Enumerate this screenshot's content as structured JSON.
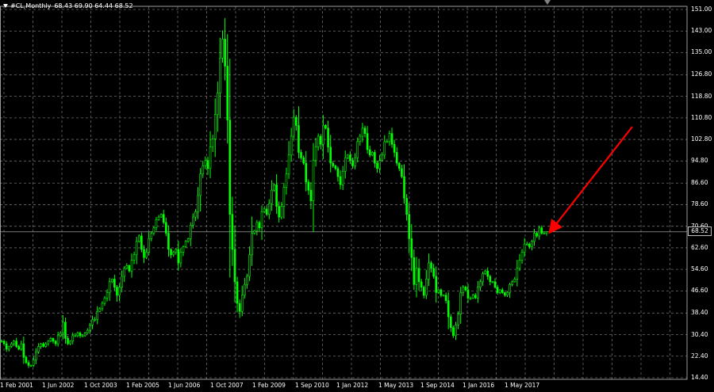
{
  "header": {
    "symbol": "#CL,Monthly",
    "ohlc": "68.43 69.90 64.44 68.52"
  },
  "current_price": "68.52",
  "colors": {
    "background": "#000000",
    "grid": "#6b6b6b",
    "candle_up": "#00ff00",
    "candle_down": "#00ff00",
    "axis_text": "#ffffff",
    "annotation_arrow": "#ff0000",
    "price_line": "#a0a0a0"
  },
  "chart_data": {
    "type": "bar",
    "ylim": [
      14.4,
      151.0
    ],
    "y_ticks": [
      "151.00",
      "143.00",
      "135.00",
      "126.80",
      "118.80",
      "110.80",
      "102.80",
      "94.80",
      "86.60",
      "78.60",
      "70.60",
      "62.60",
      "54.60",
      "46.60",
      "38.40",
      "30.40",
      "22.40",
      "14.40"
    ],
    "x_ticks": [
      "1 Feb 2001",
      "1 Jun 2002",
      "1 Oct 2003",
      "1 Feb 2005",
      "1 Jun 2006",
      "1 Oct 2007",
      "1 Feb 2009",
      "1 Sep 2010",
      "1 Jan 2012",
      "1 May 2013",
      "1 Sep 2014",
      "1 Jan 2016",
      "1 May 2017"
    ],
    "series": [
      {
        "values": [
          28,
          27,
          25,
          26,
          27,
          28,
          26,
          25,
          27,
          22,
          20,
          19,
          19,
          21,
          24,
          26,
          27,
          26,
          27,
          28,
          29,
          28,
          27,
          30,
          31,
          35,
          29,
          27,
          28,
          30,
          30,
          31,
          30,
          30,
          31,
          32,
          34,
          36,
          36,
          39,
          40,
          42,
          44,
          46,
          50,
          51,
          48,
          45,
          48,
          52,
          55,
          56,
          54,
          58,
          60,
          65,
          67,
          62,
          59,
          61,
          66,
          68,
          70,
          73,
          74,
          75,
          72,
          68,
          62,
          60,
          61,
          62,
          57,
          61,
          63,
          65,
          66,
          71,
          74,
          76,
          82,
          90,
          93,
          95,
          92,
          100,
          103,
          112,
          120,
          133,
          140,
          130,
          110,
          75,
          62,
          50,
          42,
          39,
          45,
          49,
          52,
          60,
          68,
          69,
          72,
          70,
          76,
          77,
          75,
          79,
          84,
          86,
          78,
          74,
          78,
          85,
          90,
          97,
          104,
          111,
          108,
          98,
          96,
          94,
          87,
          84,
          80,
          95,
          100,
          104,
          101,
          108,
          107,
          100,
          94,
          93,
          92,
          89,
          86,
          91,
          96,
          97,
          95,
          93,
          96,
          102,
          104,
          107,
          105,
          99,
          97,
          98,
          94,
          92,
          95,
          97,
          102,
          102,
          105,
          101,
          98,
          94,
          92,
          89,
          81,
          75,
          66,
          59,
          49,
          55,
          50,
          48,
          45,
          51,
          57,
          55,
          52,
          46,
          47,
          45,
          45,
          43,
          37,
          33,
          30,
          34,
          38,
          46,
          48,
          47,
          44,
          44,
          45,
          44,
          48,
          50,
          53,
          54,
          52,
          50,
          50,
          48,
          46,
          47,
          46,
          45,
          46,
          49,
          50,
          51,
          55,
          58,
          61,
          64,
          64,
          63,
          65,
          68,
          67,
          70,
          68,
          68,
          68.52
        ]
      }
    ]
  }
}
